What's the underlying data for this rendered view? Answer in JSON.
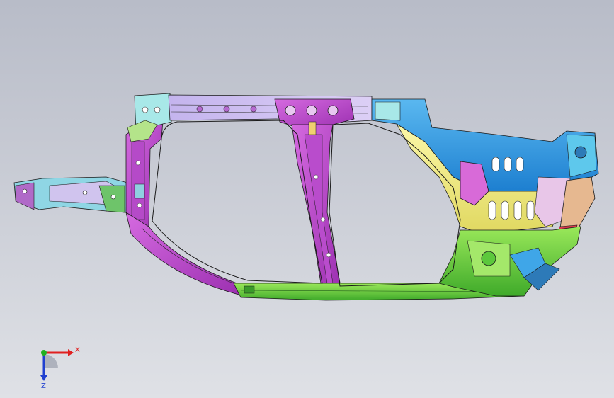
{
  "viewport": {
    "background_top": "#b8bcc8",
    "background_bottom": "#dfe1e6"
  },
  "model": {
    "part_colors": {
      "magenta": "#c04fd0",
      "violet": "#a36ad8",
      "lavender": "#c9b6ee",
      "cyan": "#7fe0e8",
      "blue": "#3fa6e8",
      "yellow": "#f2ee8a",
      "green": "#7fdc3a",
      "green_dark": "#46b82c",
      "pink": "#e6a6d6",
      "red": "#d8384c",
      "edge": "#1a1a1a"
    }
  },
  "triad": {
    "x_label": "X",
    "z_label": "Z",
    "x_color": "#e02020",
    "y_color": "#20b020",
    "z_color": "#2040d0"
  }
}
